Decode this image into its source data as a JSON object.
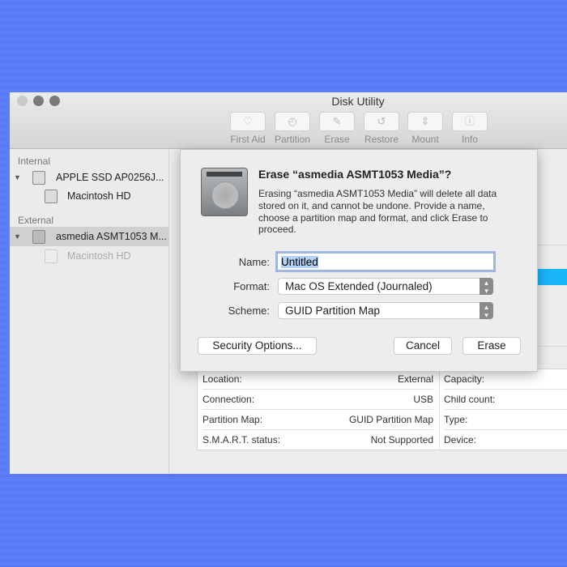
{
  "window": {
    "title": "Disk Utility"
  },
  "toolbar": [
    {
      "label": "First Aid",
      "icon": "stethoscope-icon",
      "glyph": "♡"
    },
    {
      "label": "Partition",
      "icon": "partition-icon",
      "glyph": "◴"
    },
    {
      "label": "Erase",
      "icon": "erase-icon",
      "glyph": "✎"
    },
    {
      "label": "Restore",
      "icon": "restore-icon",
      "glyph": "↺"
    },
    {
      "label": "Mount",
      "icon": "mount-icon",
      "glyph": "⇕"
    },
    {
      "label": "Info",
      "icon": "info-icon",
      "glyph": "ⓘ"
    }
  ],
  "sidebar": {
    "internal_label": "Internal",
    "external_label": "External",
    "items": [
      {
        "label": "APPLE SSD AP0256J..."
      },
      {
        "label": "Macintosh HD"
      },
      {
        "label": "asmedia ASMT1053 M..."
      },
      {
        "label": "Macintosh HD"
      }
    ]
  },
  "info": {
    "left": [
      {
        "k": "Location:",
        "v": "External"
      },
      {
        "k": "Connection:",
        "v": "USB"
      },
      {
        "k": "Partition Map:",
        "v": "GUID Partition Map"
      },
      {
        "k": "S.M.A.R.T. status:",
        "v": "Not Supported"
      }
    ],
    "right": [
      "Capacity:",
      "Child count:",
      "Type:",
      "Device:"
    ]
  },
  "dialog": {
    "title": "Erase “asmedia ASMT1053 Media”?",
    "message": "Erasing “asmedia ASMT1053 Media” will delete all data stored on it, and cannot be undone. Provide a name, choose a partition map and format, and click Erase to proceed.",
    "name_label": "Name:",
    "name_value": "Untitled",
    "format_label": "Format:",
    "format_value": "Mac OS Extended (Journaled)",
    "scheme_label": "Scheme:",
    "scheme_value": "GUID Partition Map",
    "security_button": "Security Options...",
    "cancel_button": "Cancel",
    "erase_button": "Erase"
  },
  "colors": {
    "background": "#5b7ef8",
    "usage_bar": "#19b5fb"
  }
}
